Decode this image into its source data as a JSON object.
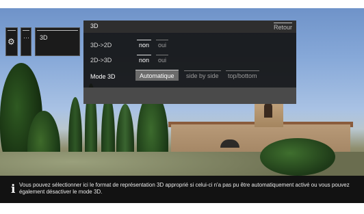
{
  "dialog": {
    "title": "3D",
    "back_label": "Retour",
    "rows": [
      {
        "label": "3D->2D",
        "options": [
          "non",
          "oui"
        ],
        "selected": "non"
      },
      {
        "label": "2D->3D",
        "options": [
          "non",
          "oui"
        ],
        "selected": "non"
      },
      {
        "label": "Mode 3D",
        "options": [
          "Automatique",
          "side by side",
          "top/bottom"
        ],
        "selected": "Automatique",
        "focused": true
      }
    ]
  },
  "toolbar": {
    "settings_icon": "gear-icon",
    "more_label": "···",
    "breadcrumb_label": "3D"
  },
  "info": {
    "icon": "info-icon",
    "text": "Vous pouvez sélectionner ici le format de représentation 3D approprié si celui-ci n'a pas pu être automatiquement activé ou vous pouvez également désactiver le mode 3D."
  }
}
